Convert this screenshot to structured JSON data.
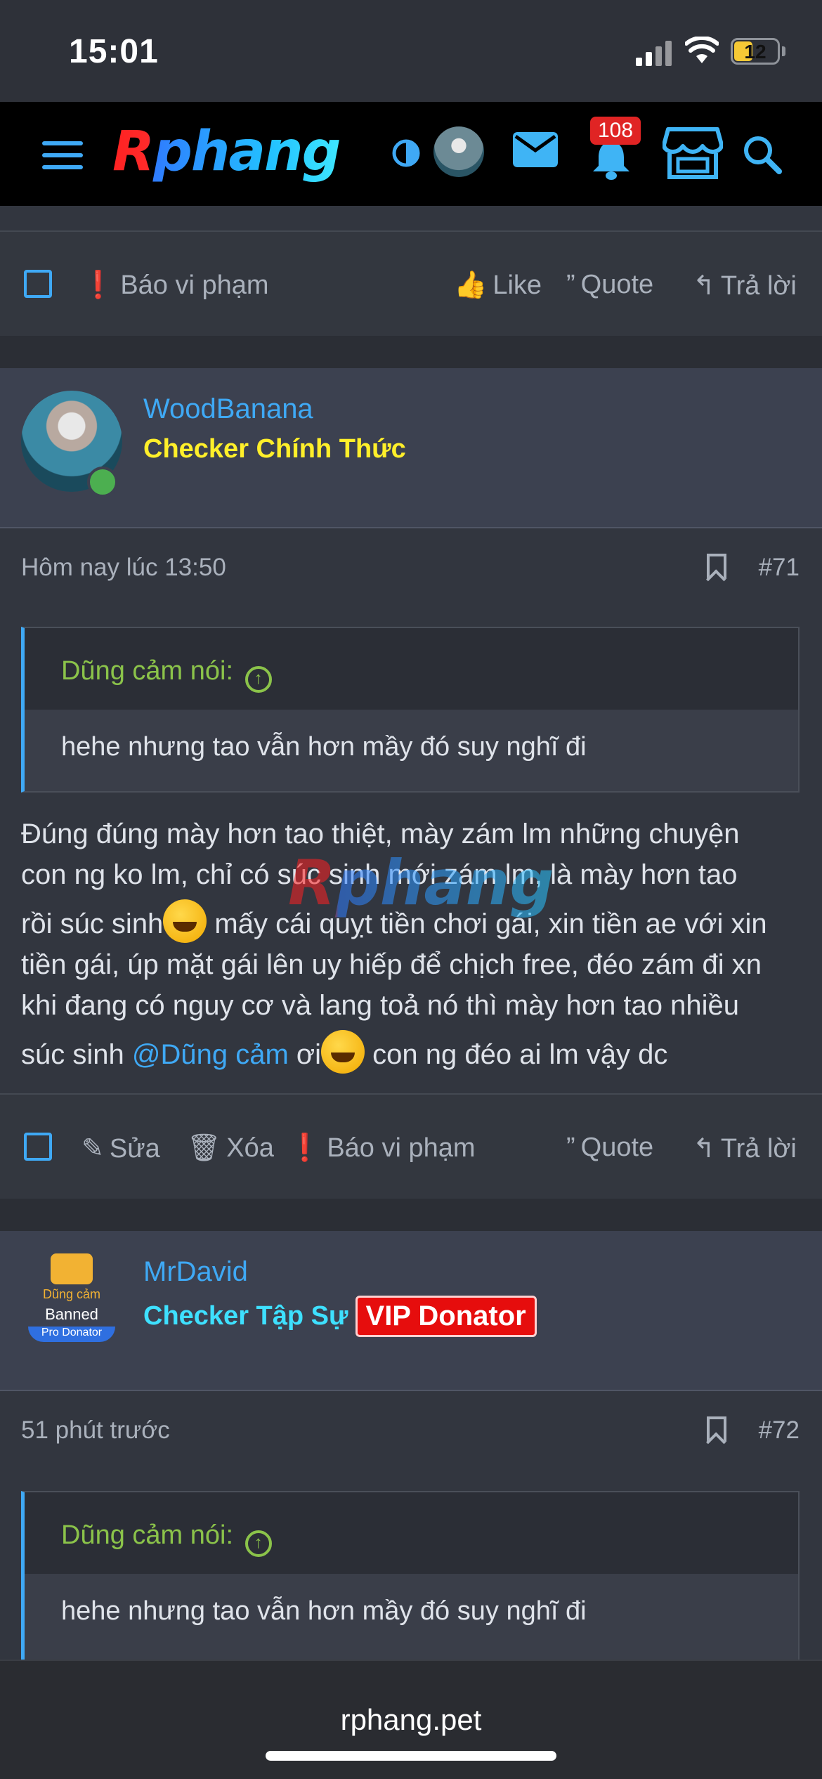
{
  "status": {
    "time": "15:01",
    "battery": "12"
  },
  "header": {
    "logo": "Rphang",
    "notif_count": "108"
  },
  "actions": {
    "report": "Báo vi phạm",
    "like": "Like",
    "quote": "Quote",
    "reply": "Trả lời",
    "edit": "Sửa",
    "delete": "Xóa"
  },
  "posts": [
    {
      "user": "WoodBanana",
      "title": "Checker Chính Thức",
      "time": "Hôm nay lúc 13:50",
      "number": "#71",
      "quote_author": "Dũng cảm nói:",
      "quote_text": "hehe nhưng tao vẫn hơn mầy đó suy nghĩ đi",
      "body_lines": [
        "Đúng đúng mày hơn tao thiệt, mày zám lm những chuyện",
        "con ng ko lm, chỉ có súc sinh mới zám lm, là mày hơn tao",
        "rồi súc sinh",
        " mấy cái quỵt tiền chơi gái, xin tiền ae với xin",
        "tiền gái, úp mặt gái lên uy hiếp để chịch free, đéo zám đi xn",
        "khi đang có nguy cơ và lang toả nó thì mày hơn tao nhiều",
        "súc sinh ",
        "@Dũng cảm",
        " ơi",
        " con ng đéo ai lm vậy dc"
      ]
    },
    {
      "user": "MrDavid",
      "title": "Checker Tập Sự",
      "badge": "VIP Donator",
      "avatar_text": [
        "Dũng cảm",
        "Banned",
        "Pro Donator"
      ],
      "time": "51 phút trước",
      "number": "#72",
      "quote_author": "Dũng cảm nói:",
      "quote_text": "hehe nhưng tao vẫn hơn mầy đó suy nghĩ đi"
    }
  ],
  "url": "rphang.pet",
  "colors": {
    "accent": "#3fa9f5",
    "gold": "#ffef2a",
    "cyan": "#3ee0ff",
    "quote_green": "#8bc34a",
    "vip": "#e60d0d"
  }
}
